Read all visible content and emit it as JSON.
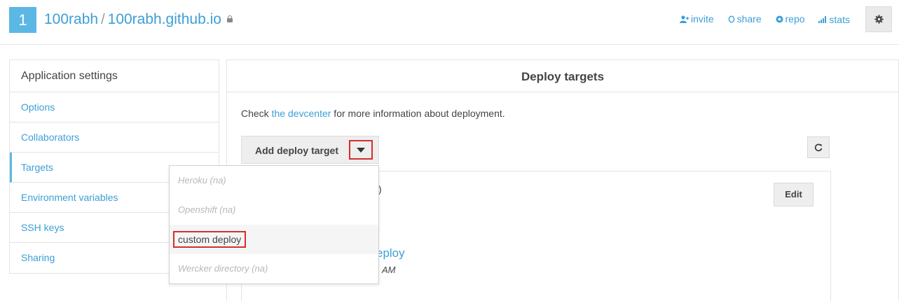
{
  "header": {
    "project_number": "1",
    "owner": "100rabh",
    "separator": "/",
    "repo": "100rabh.github.io",
    "links": {
      "invite": "invite",
      "share": "share",
      "repo": "repo",
      "stats": "stats"
    },
    "settings_icon": "gear-icon"
  },
  "sidebar": {
    "title": "Application settings",
    "items": [
      {
        "label": "Options"
      },
      {
        "label": "Collaborators"
      },
      {
        "label": "Targets",
        "active": true
      },
      {
        "label": "Environment variables"
      },
      {
        "label": "SSH keys"
      },
      {
        "label": "Sharing"
      }
    ]
  },
  "main": {
    "title": "Deploy targets",
    "info_prefix": "Check ",
    "info_link": "the devcenter",
    "info_suffix": " for more information about deployment.",
    "add_button_label": "Add deploy target",
    "card": {
      "paren_fragment": ")",
      "edit_label": "Edit",
      "link_fragment": "eploy",
      "time_fragment": "AM"
    }
  },
  "dropdown": {
    "items": [
      {
        "label": "Heroku (na)",
        "enabled": false
      },
      {
        "label": "Openshift (na)",
        "enabled": false
      },
      {
        "label": "custom deploy",
        "enabled": true
      },
      {
        "label": "Wercker directory (na)",
        "enabled": false
      }
    ]
  },
  "colors": {
    "accent": "#5bb8e4",
    "link": "#3c9fd6",
    "highlight": "#d32f2f"
  }
}
